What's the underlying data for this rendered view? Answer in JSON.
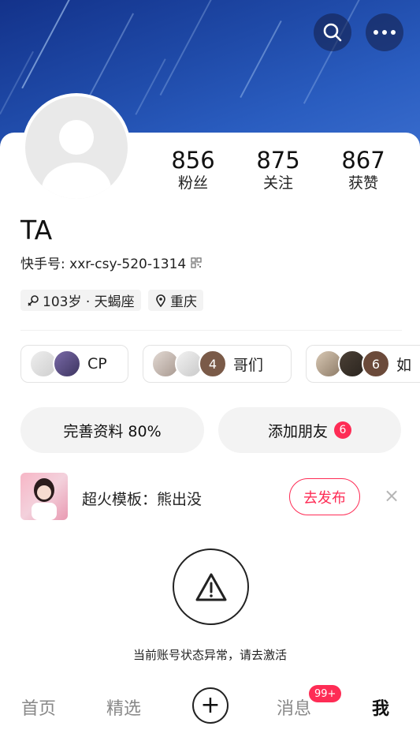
{
  "header": {
    "search_icon": "search-icon",
    "more_icon": "more-dots-icon"
  },
  "profile": {
    "avatar_icon": "default-avatar-icon",
    "name": "TA",
    "kuaishou_id": "快手号: xxr-csy-520-1314",
    "qr_icon": "qrcode-icon",
    "stats": [
      {
        "value": "856",
        "label": "粉丝"
      },
      {
        "value": "875",
        "label": "关注"
      },
      {
        "value": "867",
        "label": "获赞"
      }
    ],
    "tags": [
      {
        "icon": "gender-icon",
        "text": "103岁 · 天蝎座"
      },
      {
        "icon": "location-icon",
        "text": "重庆"
      }
    ]
  },
  "relations": [
    {
      "label": "CP",
      "count": ""
    },
    {
      "label": "哥们",
      "count": "4"
    },
    {
      "label": "如",
      "count": "6"
    }
  ],
  "actions": {
    "complete_profile": "完善资料 80%",
    "add_friend": "添加朋友",
    "add_friend_badge": "6"
  },
  "promo": {
    "text": "超火模板：熊出没",
    "button": "去发布",
    "close_icon": "close-icon"
  },
  "notice": {
    "icon": "warning-icon",
    "text": "当前账号状态异常，请去激活"
  },
  "tabbar": {
    "home": "首页",
    "featured": "精选",
    "plus": "+",
    "messages": "消息",
    "messages_badge": "99+",
    "me": "我"
  },
  "colors": {
    "accent": "#fe2c55",
    "banner": "#1f4aa8"
  }
}
